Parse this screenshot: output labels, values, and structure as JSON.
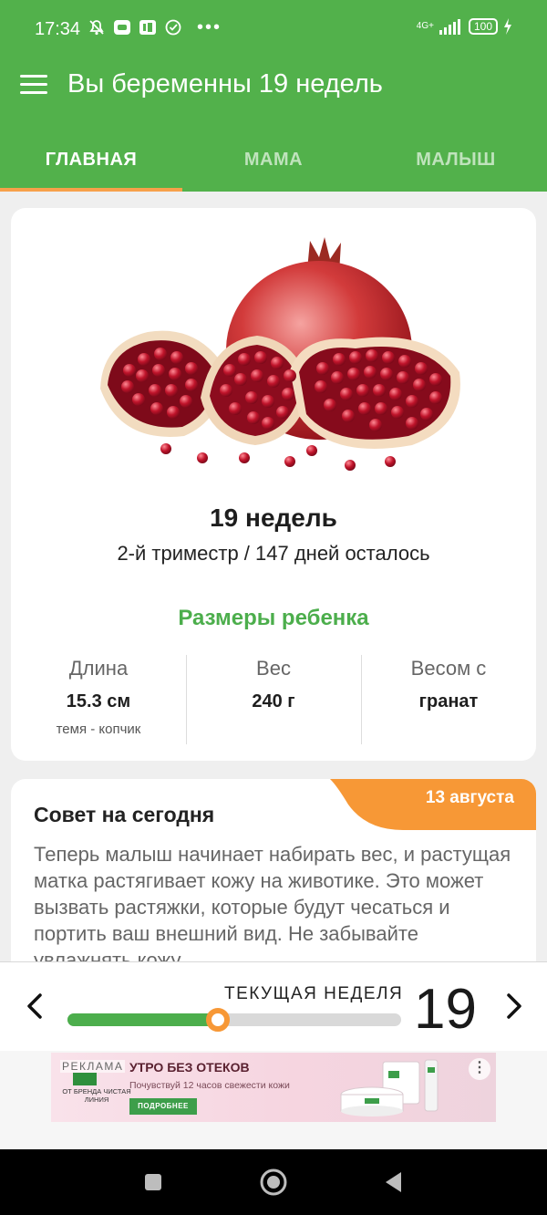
{
  "status_bar": {
    "time": "17:34",
    "network": "4G+",
    "battery": "100",
    "icons": [
      "muted-alarm-icon",
      "mail-app-icon",
      "office-app-icon",
      "check-circle-icon",
      "more-dots-icon",
      "signal-icon",
      "battery-icon",
      "charging-icon"
    ]
  },
  "header": {
    "title": "Вы беременны 19 недель",
    "tabs": [
      {
        "label": "ГЛАВНАЯ",
        "active": true
      },
      {
        "label": "МАМА",
        "active": false
      },
      {
        "label": "МАЛЫШ",
        "active": false
      }
    ]
  },
  "week_card": {
    "fruit_icon": "pomegranate-illustration",
    "weeks_title": "19 недель",
    "trimester": "2-й триместр / 147 дней осталось",
    "sizes_title": "Размеры ребенка",
    "stats": [
      {
        "label": "Длина",
        "value": "15.3 см",
        "sub": "темя - копчик"
      },
      {
        "label": "Вес",
        "value": "240 г",
        "sub": ""
      },
      {
        "label": "Весом с",
        "value": "гранат",
        "sub": ""
      }
    ]
  },
  "tip_card": {
    "date": "13 августа",
    "title": "Совет на сегодня",
    "text": "Теперь малыш начинает набирать вес, и растущая матка растягивает кожу на животике. Это может вызвать растяжки, которые будут чесаться и портить ваш внешний вид. Не забывайте увлажнять кожу"
  },
  "week_selector": {
    "label": "ТЕКУЩАЯ НЕДЕЛЯ",
    "week": "19",
    "progress_fraction": 0.45
  },
  "ad": {
    "tag": "РЕКЛАМА",
    "brand": "ОТ БРЕНДА ЧИСТАЯ ЛИНИЯ",
    "headline": "УТРО БЕЗ ОТЕКОВ",
    "subtext": "Почувствуй 12 часов свежести кожи",
    "button": "ПОДРОБНЕЕ"
  },
  "colors": {
    "brand_green": "#52b14b",
    "accent_orange": "#f79836"
  }
}
